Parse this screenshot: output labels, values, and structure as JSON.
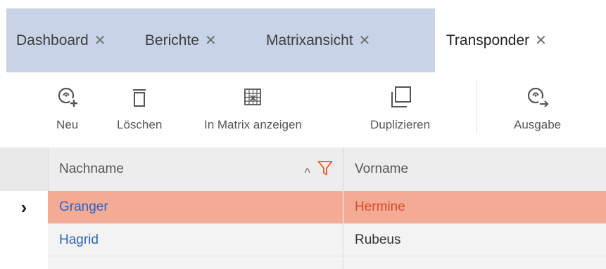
{
  "tabs": [
    {
      "label": "Dashboard",
      "close": "✕"
    },
    {
      "label": "Berichte",
      "close": "✕"
    },
    {
      "label": "Matrixansicht",
      "close": "✕"
    },
    {
      "label": "Transponder",
      "close": "✕",
      "active": true
    }
  ],
  "toolbar": {
    "neu": "Neu",
    "loeschen": "Löschen",
    "matrix": "In Matrix anzeigen",
    "duplizieren": "Duplizieren",
    "ausgabe": "Ausgabe"
  },
  "table": {
    "columns": [
      "Nachname",
      "Vorname"
    ],
    "rows": [
      {
        "nachname": "Granger",
        "vorname": "Hermine",
        "selected": true
      },
      {
        "nachname": "Hagrid",
        "vorname": "Rubeus"
      }
    ],
    "row_indicator": "›",
    "sort_glyph": "^"
  },
  "colors": {
    "tabbar": "#c9d3e7",
    "selected_row": "#f3ab95",
    "link": "#2b62c4",
    "selected_text": "#d84a2a",
    "accent": "#e8562c"
  },
  "icons": [
    "transponder-new-icon",
    "trash-icon",
    "matrix-icon",
    "duplicate-icon",
    "transponder-output-icon",
    "filter-icon",
    "sort-up-icon",
    "row-pointer-icon"
  ]
}
